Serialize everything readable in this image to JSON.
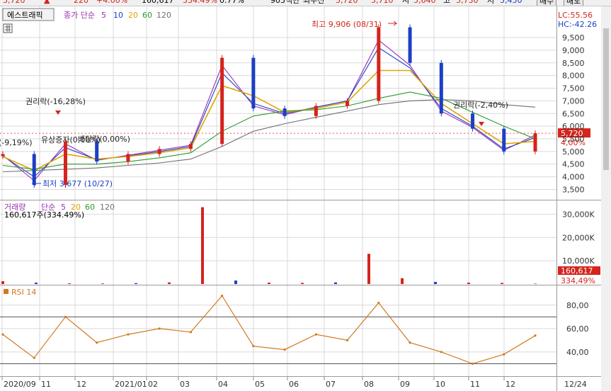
{
  "header": {
    "price": "5,720",
    "change_arrow": "▲",
    "change": "220",
    "change_pct": "+4.00%",
    "volume": "160,617",
    "volume_ratio": "334.49%",
    "turnover": "0.77%",
    "amount_label": "903백만",
    "last_label": "최우선",
    "ask": "5,720",
    "bid": "5,710",
    "open_label": "시",
    "open": "5,640",
    "high_label": "고",
    "high": "5,730",
    "low_label": "저",
    "low": "5,450",
    "sell_label": "매수",
    "buy_label": "매도"
  },
  "panel_tab": {
    "label": "에스트래픽"
  },
  "price_legend": {
    "title": "종가 단순",
    "ma": [
      "5",
      "10",
      "20",
      "60",
      "120"
    ]
  },
  "lc": "LC:55.56",
  "hc": "HC:-42.26",
  "volume_legend": {
    "title": "거래량",
    "ma_title": "단순",
    "ma": [
      "5",
      "20",
      "60",
      "120"
    ],
    "sub": "160,617주(334.49%)"
  },
  "rsi_legend": {
    "title": "RSI 14"
  },
  "colors": {
    "up": "#d4241c",
    "down": "#1c3fc4",
    "ma5": "#9b2fb0",
    "ma10": "#1c3fc4",
    "ma20": "#e0a400",
    "ma60": "#2a9a2a",
    "ma120": "#707070",
    "rsi": "#d07a20",
    "grid": "#d9d9d9",
    "current_box": "#d4241c"
  },
  "chart_data": [
    {
      "type": "candlestick",
      "title": "",
      "ylim": [
        3150,
        10200
      ],
      "y_ticks": [
        "9,500",
        "9,000",
        "8,500",
        "8,000",
        "7,500",
        "7,000",
        "6,500",
        "6,000",
        "5,500",
        "5,000",
        "4,500",
        "4,000",
        "3,500"
      ],
      "x_ticks": [
        "2020/09",
        "11",
        "12",
        "2021/01",
        "02",
        "03",
        "04",
        "05",
        "06",
        "07",
        "08",
        "09",
        "10",
        "11",
        "12",
        "12/24"
      ],
      "current_price_label": "5,720",
      "current_change_label": "4,00%",
      "annotations": [
        {
          "text": "최고 9,906 (08/31)",
          "kind": "high"
        },
        {
          "text": "최저 3,677 (10/27)",
          "kind": "low"
        },
        {
          "text": "권리락(-16,28%)",
          "kind": "event"
        },
        {
          "text": "권리락(-2,40%)",
          "kind": "event"
        },
        {
          "text": "(-9,19%)",
          "kind": "event"
        },
        {
          "text": "유상증자(0,00%)",
          "kind": "event"
        },
        {
          "text": "배당락(0,00%)",
          "kind": "event"
        }
      ],
      "series": [
        {
          "name": "Close",
          "x": [
            "2020/09",
            "10/27",
            "11",
            "12",
            "2021/01",
            "02",
            "03",
            "04",
            "05",
            "06",
            "07",
            "08",
            "08/31",
            "09",
            "10",
            "11",
            "12",
            "12/24"
          ],
          "values": [
            4900,
            3677,
            5400,
            4600,
            4900,
            5100,
            5300,
            8700,
            6700,
            6400,
            6800,
            7000,
            9906,
            8500,
            6500,
            5900,
            5000,
            5720
          ]
        },
        {
          "name": "5",
          "values": [
            4850,
            3850,
            5300,
            4650,
            4850,
            5050,
            5250,
            8400,
            6800,
            6450,
            6750,
            7000,
            9400,
            8400,
            6600,
            5950,
            5050,
            5650
          ]
        },
        {
          "name": "10",
          "values": [
            4820,
            4000,
            5150,
            4680,
            4820,
            5000,
            5200,
            8100,
            6900,
            6500,
            6750,
            7000,
            9100,
            8300,
            6700,
            6000,
            5100,
            5550
          ]
        },
        {
          "name": "20",
          "values": [
            4800,
            4250,
            4900,
            4700,
            4800,
            4950,
            5150,
            7600,
            7200,
            6550,
            6700,
            6950,
            8200,
            8200,
            6900,
            6100,
            5300,
            5400
          ]
        },
        {
          "name": "60",
          "values": [
            4450,
            4300,
            4500,
            4500,
            4600,
            4750,
            4950,
            5800,
            6400,
            6600,
            6650,
            6800,
            7100,
            7350,
            7100,
            6550,
            6000,
            5500
          ]
        },
        {
          "name": "120",
          "values": [
            4200,
            4250,
            4300,
            4350,
            4450,
            4550,
            4700,
            5200,
            5800,
            6100,
            6350,
            6600,
            6850,
            7000,
            7050,
            7000,
            6850,
            6750
          ]
        }
      ]
    },
    {
      "type": "bar",
      "title": "",
      "ylim": [
        0,
        35000
      ],
      "y_ticks": [
        "30,000K",
        "20,000K",
        "10,000K"
      ],
      "current_volume_label": "160,617",
      "current_ratio_label": "334,49%",
      "x": [
        "2020/09",
        "11",
        "12",
        "2021/01",
        "02",
        "03",
        "04",
        "05",
        "06",
        "07",
        "08",
        "08/31",
        "09",
        "10",
        "11",
        "12",
        "12/24"
      ],
      "values": [
        1200,
        600,
        300,
        250,
        400,
        700,
        33000,
        1500,
        600,
        500,
        700,
        13000,
        2500,
        900,
        600,
        500,
        160
      ]
    },
    {
      "type": "line",
      "title": "",
      "ylim": [
        20,
        95
      ],
      "y_ticks": [
        "80,00",
        "60,00",
        "40,00"
      ],
      "reference_lines": [
        70,
        30
      ],
      "x": [
        "2020/09",
        "10/27",
        "11",
        "12",
        "2021/01",
        "02",
        "03",
        "04",
        "05",
        "06",
        "07",
        "08",
        "08/31",
        "09",
        "10",
        "11",
        "12",
        "12/24"
      ],
      "values": [
        55,
        35,
        70,
        48,
        55,
        60,
        57,
        88,
        45,
        42,
        55,
        50,
        82,
        48,
        40,
        30,
        38,
        54
      ]
    }
  ]
}
